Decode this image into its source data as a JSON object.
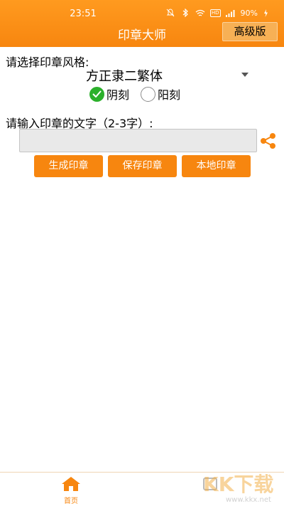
{
  "status_bar": {
    "time": "23:51",
    "hd": "HD",
    "battery": "90%"
  },
  "header": {
    "title": "印章大师",
    "advanced_label": "高级版"
  },
  "form": {
    "style_label": "请选择印章风格:",
    "font_value": "方正隶二繁体",
    "radio_yin": "阴刻",
    "radio_yang": "阳刻",
    "selected": "阴刻",
    "text_label": "请输入印章的文字（2-3字）:",
    "text_value": ""
  },
  "buttons": {
    "generate": "生成印章",
    "save": "保存印章",
    "local": "本地印章"
  },
  "bottom_nav": {
    "home_label": "首页"
  },
  "watermark": {
    "main": "KK下载",
    "url": "www.kkx.net"
  },
  "colors": {
    "accent": "#f7860f",
    "radio_checked": "#2bb02b"
  },
  "icons": [
    "mute-icon",
    "bluetooth-icon",
    "wifi-icon",
    "signal-icon",
    "battery-icon",
    "share-icon",
    "home-icon",
    "dropdown-arrow-icon"
  ]
}
